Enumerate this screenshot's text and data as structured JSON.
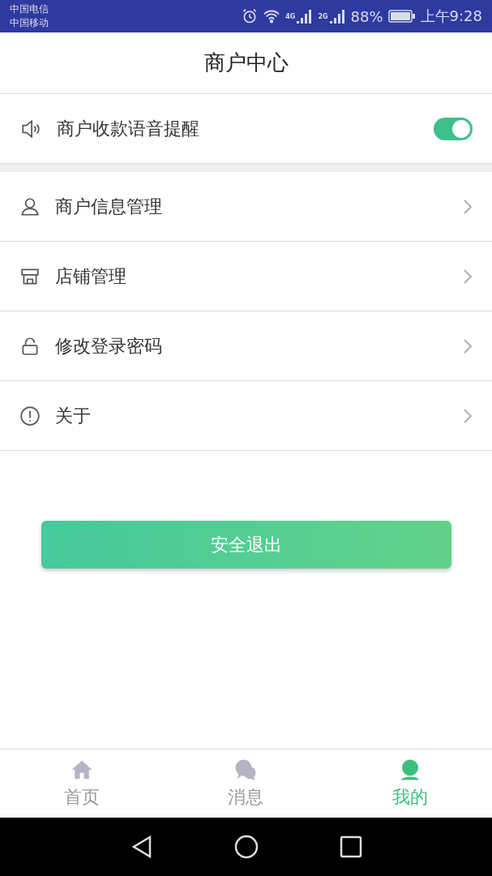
{
  "status_bar": {
    "carriers": [
      "中国电信",
      "中国移动"
    ],
    "network_labels": [
      "4G",
      "2G"
    ],
    "battery": "88%",
    "time": "上午9:28"
  },
  "header": {
    "title": "商户中心"
  },
  "voice_setting": {
    "label": "商户收款语音提醒",
    "on": true
  },
  "menu": [
    {
      "label": "商户信息管理"
    },
    {
      "label": "店铺管理"
    },
    {
      "label": "修改登录密码"
    },
    {
      "label": "关于"
    }
  ],
  "logout_button": "安全退出",
  "bottom_nav": [
    {
      "label": "首页",
      "selected": false
    },
    {
      "label": "消息",
      "selected": false
    },
    {
      "label": "我的",
      "selected": true
    }
  ]
}
